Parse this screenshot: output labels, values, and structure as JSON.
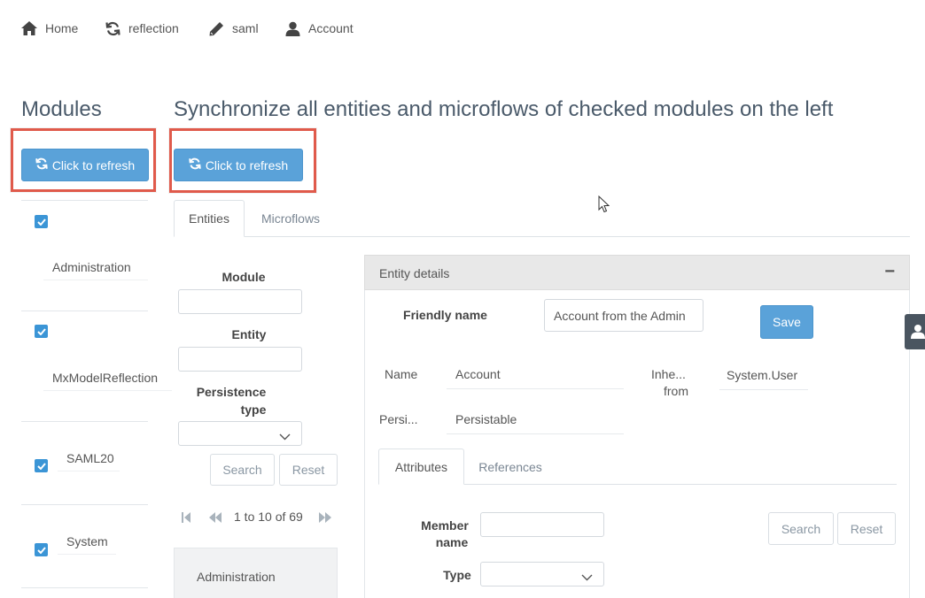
{
  "nav": {
    "items": [
      {
        "label": "Home",
        "icon": "home-icon"
      },
      {
        "label": "reflection",
        "icon": "refresh-icon"
      },
      {
        "label": "saml",
        "icon": "pencil-icon"
      },
      {
        "label": "Account",
        "icon": "user-icon"
      }
    ]
  },
  "modules_panel": {
    "title": "Modules",
    "refresh_label": "Click to refresh",
    "modules": [
      {
        "name": "Administration",
        "checked": true
      },
      {
        "name": "MxModelReflection",
        "checked": true
      },
      {
        "name": "SAML20",
        "checked": true
      },
      {
        "name": "System",
        "checked": true
      }
    ]
  },
  "main": {
    "title": "Synchronize all entities and microflows of checked modules on the left",
    "refresh_label": "Click to refresh",
    "tabs": [
      {
        "label": "Entities",
        "active": true
      },
      {
        "label": "Microflows",
        "active": false
      }
    ]
  },
  "entity_search": {
    "module_label": "Module",
    "entity_label": "Entity",
    "persistence_label_line1": "Persistence",
    "persistence_label_line2": "type",
    "module_value": "",
    "entity_value": "",
    "persistence_value": "",
    "search_label": "Search",
    "reset_label": "Reset",
    "paging_text": "1 to 10 of 69",
    "first_row": "Administration"
  },
  "entity_details": {
    "header": "Entity details",
    "collapse_symbol": "−",
    "friendly_name_label": "Friendly name",
    "friendly_name_value": "Account from the Admin",
    "save_label": "Save",
    "name_label": "Name",
    "name_value": "Account",
    "inherits_label_line1": "Inhe...",
    "inherits_label_line2": "from",
    "inherits_value": "System.User",
    "persistable_label": "Persi...",
    "persistable_value": "Persistable",
    "tabs": [
      {
        "label": "Attributes",
        "active": true
      },
      {
        "label": "References",
        "active": false
      }
    ],
    "member_name_label_line1": "Member",
    "member_name_label_line2": "name",
    "member_name_value": "",
    "type_label": "Type",
    "type_value": "",
    "search_label": "Search",
    "reset_label": "Reset"
  },
  "colors": {
    "primary": "#5aa2d9",
    "highlight": "#e05a4b",
    "checkbox": "#3b95d6",
    "title": "#4a5a6a"
  }
}
